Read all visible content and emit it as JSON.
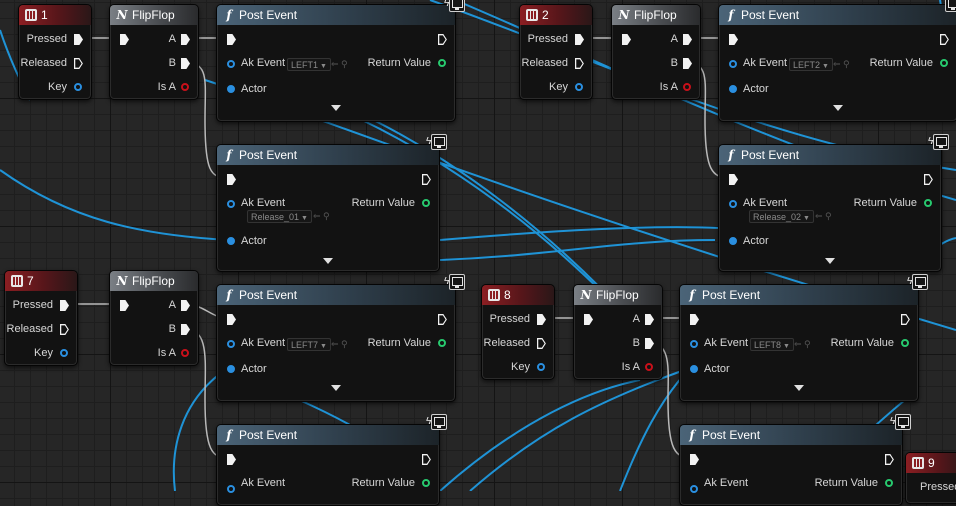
{
  "colors": {
    "wire": "#1f93d6",
    "wire_exec": "#b9b9b9",
    "key_header": "#8b1e22",
    "flipflop_header": "#6e7278",
    "post_header": "#405567",
    "pin_blue": "#2a8fe0",
    "pin_red": "#c8101a",
    "pin_green": "#27c96e"
  },
  "icons": {
    "key_node": "keyboard-icon",
    "flipflop_node": "macro-icon",
    "post_node": "function-icon",
    "target": "monitor-icon",
    "collapse": "chevron-down-icon"
  },
  "keys": [
    {
      "title": "1",
      "pressed": "Pressed",
      "released": "Released",
      "key": "Key"
    },
    {
      "title": "2",
      "pressed": "Pressed",
      "released": "Released",
      "key": "Key"
    },
    {
      "title": "7",
      "pressed": "Pressed",
      "released": "Released",
      "key": "Key"
    },
    {
      "title": "8",
      "pressed": "Pressed",
      "released": "Released",
      "key": "Key"
    },
    {
      "title": "9",
      "pressed": "Pressed"
    }
  ],
  "flipflops": [
    {
      "title": "FlipFlop",
      "a": "A",
      "b": "B",
      "is_a": "Is A"
    },
    {
      "title": "FlipFlop",
      "a": "A",
      "b": "B",
      "is_a": "Is A"
    },
    {
      "title": "FlipFlop",
      "a": "A",
      "b": "B",
      "is_a": "Is A"
    },
    {
      "title": "FlipFlop",
      "a": "A",
      "b": "B",
      "is_a": "Is A"
    }
  ],
  "posts": [
    {
      "title": "Post Event",
      "ak_event": "Ak Event",
      "value": "LEFT1",
      "return_value": "Return Value",
      "actor": "Actor"
    },
    {
      "title": "Post Event",
      "ak_event": "Ak Event",
      "value": "LEFT2",
      "return_value": "Return Value",
      "actor": "Actor"
    },
    {
      "title": "Post Event",
      "ak_event": "Ak Event",
      "value": "Release_01",
      "return_value": "Return Value",
      "actor": "Actor"
    },
    {
      "title": "Post Event",
      "ak_event": "Ak Event",
      "value": "Release_02",
      "return_value": "Return Value",
      "actor": "Actor"
    },
    {
      "title": "Post Event",
      "ak_event": "Ak Event",
      "value": "LEFT7",
      "return_value": "Return Value",
      "actor": "Actor"
    },
    {
      "title": "Post Event",
      "ak_event": "Ak Event",
      "value": "LEFT8",
      "return_value": "Return Value",
      "actor": "Actor"
    },
    {
      "title": "Post Event",
      "ak_event": "Ak Event",
      "return_value": "Return Value"
    },
    {
      "title": "Post Event",
      "ak_event": "Ak Event",
      "return_value": "Return Value"
    }
  ]
}
